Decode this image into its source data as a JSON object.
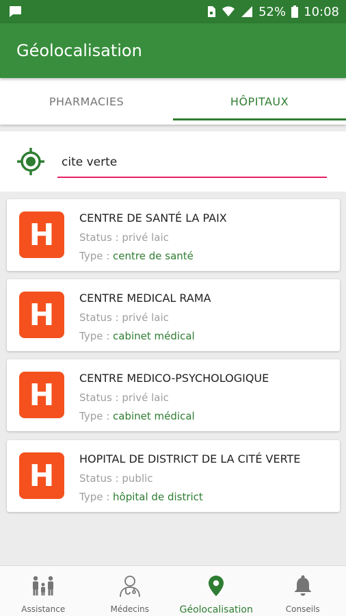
{
  "status_bar": {
    "battery": "52%",
    "time": "10:08"
  },
  "app_bar": {
    "title": "Géolocalisation"
  },
  "tabs": [
    {
      "label": "PHARMACIES",
      "active": false
    },
    {
      "label": "HÔPITAUX",
      "active": true
    }
  ],
  "search": {
    "value": "cite verte"
  },
  "results": [
    {
      "icon": "hospital-icon",
      "icon_letter": "H",
      "name": "CENTRE DE SANTÉ LA PAIX",
      "status": "Status : privé laic",
      "type_label": "Type : ",
      "type_value": "centre de santé"
    },
    {
      "icon": "hospital-icon",
      "icon_letter": "H",
      "name": "CENTRE MEDICAL RAMA",
      "status": "Status : privé laic",
      "type_label": "Type : ",
      "type_value": "cabinet médical"
    },
    {
      "icon": "hospital-icon",
      "icon_letter": "H",
      "name": "CENTRE MEDICO-PSYCHOLOGIQUE",
      "status": "Status : privé laic",
      "type_label": "Type : ",
      "type_value": "cabinet médical"
    },
    {
      "icon": "hospital-icon",
      "icon_letter": "H",
      "name": "HOPITAL DE DISTRICT DE LA CITÉ VERTE",
      "status": "Status : public",
      "type_label": "Type : ",
      "type_value": "hôpital de district"
    }
  ],
  "bottom_nav": [
    {
      "label": "Assistance",
      "icon": "family-icon",
      "active": false
    },
    {
      "label": "Médecins",
      "icon": "doctor-icon",
      "active": false
    },
    {
      "label": "Géolocalisation",
      "icon": "location-pin-icon",
      "active": true
    },
    {
      "label": "Conseils",
      "icon": "bell-icon",
      "active": false
    }
  ],
  "colors": {
    "primary_dark": "#2e7d32",
    "primary": "#388e3c",
    "accent_underline": "#e91e63",
    "hospital_icon": "#f4511e"
  }
}
